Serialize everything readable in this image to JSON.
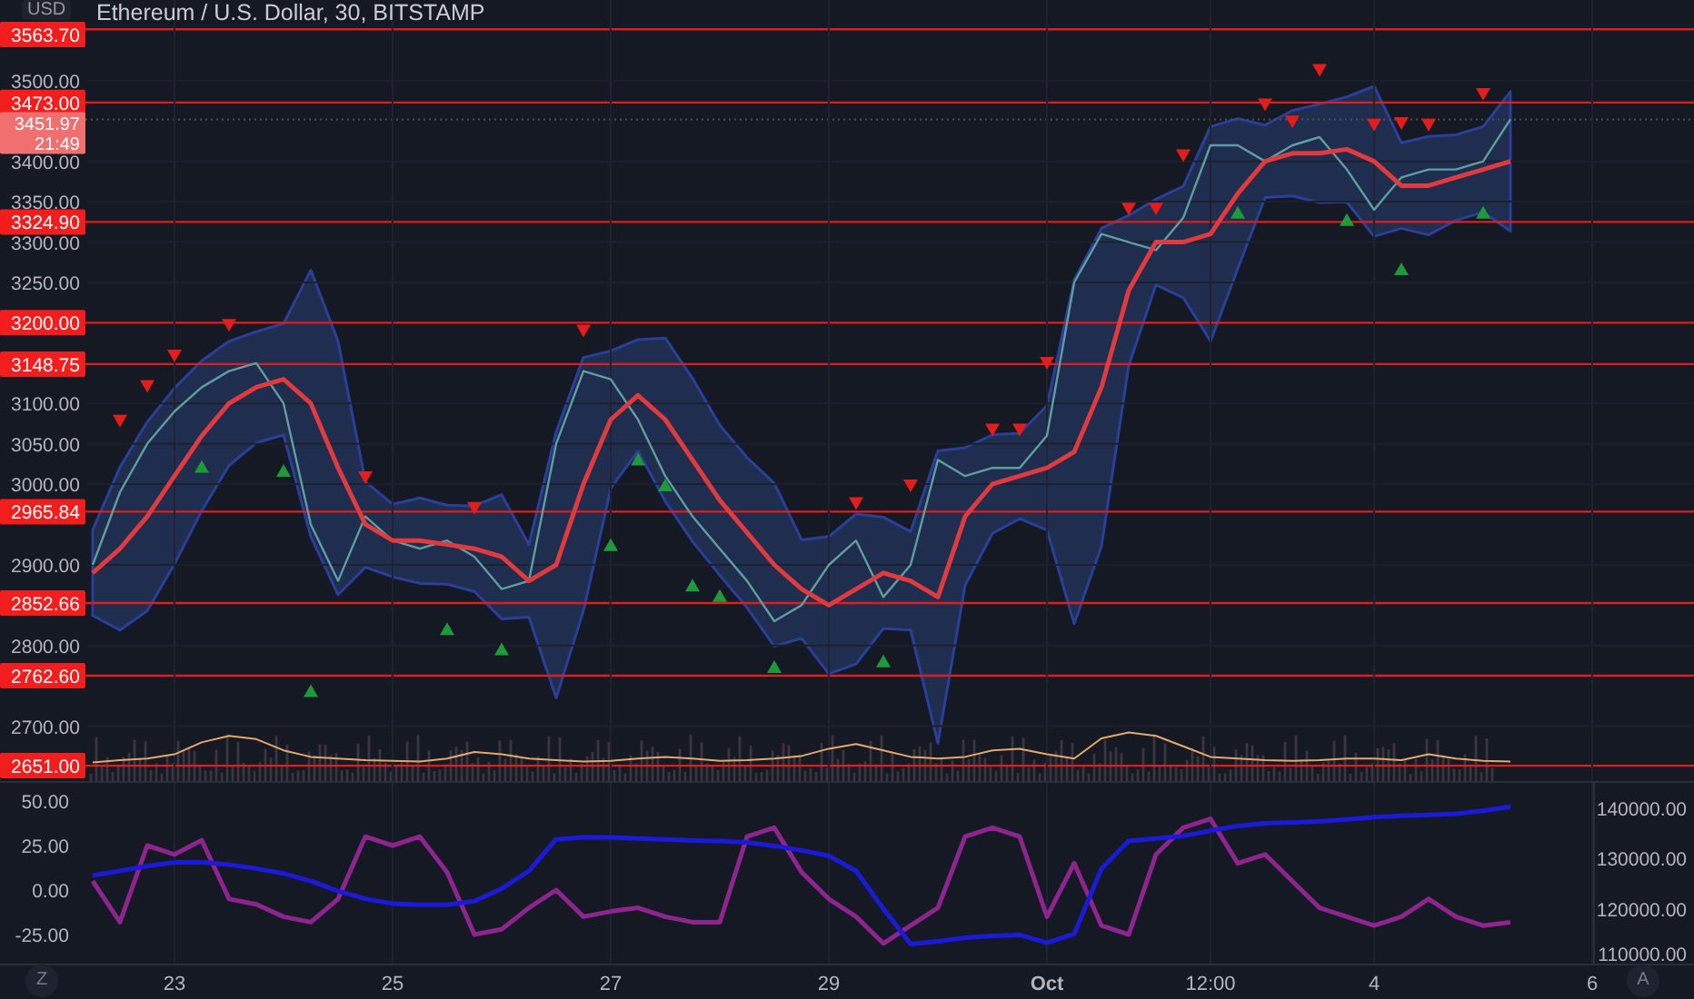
{
  "header": {
    "title": "Ethereum / U.S. Dollar, 30, BITSTAMP",
    "currency": "USD"
  },
  "price_chart": {
    "chart_data": {
      "type": "line",
      "grid": true,
      "series": [
        {
          "color": "#5f9ea0",
          "values": [
            2900,
            2990,
            3050,
            3090,
            3120,
            3140,
            3150,
            3100,
            2950,
            2880,
            2960,
            2930,
            2920,
            2930,
            2910,
            2870,
            2880,
            3050,
            3140,
            3130,
            3080,
            3010,
            2960,
            2920,
            2880,
            2830,
            2850,
            2900,
            2930,
            2860,
            2900,
            3030,
            3010,
            3020,
            3020,
            3060,
            3250,
            3310,
            3300,
            3290,
            3330,
            3420,
            3420,
            3400,
            3420,
            3430,
            3390,
            3340,
            3380,
            3390,
            3390,
            3400,
            3452
          ]
        },
        {
          "color": "#e03a3e",
          "values": [
            2890,
            2920,
            2960,
            3010,
            3060,
            3100,
            3120,
            3130,
            3100,
            3020,
            2950,
            2930,
            2930,
            2925,
            2920,
            2910,
            2880,
            2900,
            3000,
            3080,
            3110,
            3080,
            3030,
            2980,
            2940,
            2900,
            2870,
            2850,
            2870,
            2890,
            2880,
            2860,
            2960,
            3000,
            3010,
            3020,
            3040,
            3120,
            3240,
            3300,
            3300,
            3310,
            3360,
            3400,
            3410,
            3410,
            3415,
            3400,
            3370,
            3370,
            3380,
            3390,
            3400
          ]
        },
        {
          "type": "scatter",
          "color": "#e31c1c",
          "values": [
            null,
            3079,
            3122,
            3160,
            null,
            3198,
            null,
            null,
            null,
            null,
            3009,
            null,
            null,
            null,
            2971,
            null,
            null,
            null,
            3191,
            null,
            null,
            null,
            null,
            null,
            null,
            null,
            null,
            null,
            2977,
            null,
            2999,
            null,
            null,
            3068,
            3068,
            3151,
            null,
            null,
            3342,
            3342,
            3408,
            null,
            null,
            3471,
            3450,
            3514,
            null,
            3446,
            3448,
            3446,
            null,
            3484,
            null
          ]
        },
        {
          "type": "scatter",
          "color": "#1f9a3a",
          "values": [
            null,
            null,
            null,
            null,
            3023,
            null,
            null,
            3018,
            2745,
            null,
            null,
            null,
            null,
            2822,
            null,
            2797,
            null,
            null,
            null,
            2926,
            3032,
            3000,
            2876,
            2863,
            null,
            2775,
            null,
            null,
            null,
            2782,
            null,
            null,
            null,
            null,
            null,
            null,
            null,
            null,
            null,
            null,
            null,
            null,
            3338,
            null,
            null,
            null,
            3329,
            null,
            3268,
            null,
            null,
            3338,
            null
          ]
        },
        {
          "color": "#e6a86a",
          "values": [
            2655,
            2658,
            2660,
            2665,
            2680,
            2688,
            2684,
            2670,
            2662,
            2660,
            2658,
            2657,
            2656,
            2660,
            2668,
            2665,
            2660,
            2658,
            2656,
            2657,
            2660,
            2662,
            2660,
            2657,
            2658,
            2660,
            2663,
            2672,
            2678,
            2670,
            2662,
            2660,
            2662,
            2670,
            2672,
            2665,
            2660,
            2685,
            2692,
            2688,
            2675,
            2662,
            2660,
            2658,
            2657,
            2658,
            2660,
            2660,
            2658,
            2665,
            2660,
            2657,
            2656
          ]
        }
      ],
      "ylim": [
        2632,
        3600
      ],
      "yticks": [
        {
          "value": 3500,
          "label": "3500.00"
        },
        {
          "value": 3400,
          "label": "3400.00"
        },
        {
          "value": 3350,
          "label": "3350.00"
        },
        {
          "value": 3300,
          "label": "3300.00"
        },
        {
          "value": 3250,
          "label": "3250.00"
        },
        {
          "value": 3100,
          "label": "3100.00"
        },
        {
          "value": 3050,
          "label": "3050.00"
        },
        {
          "value": 3000,
          "label": "3000.00"
        },
        {
          "value": 2900,
          "label": "2900.00"
        },
        {
          "value": 2800,
          "label": "2800.00"
        },
        {
          "value": 2700,
          "label": "2700.00"
        }
      ]
    }
  },
  "price_levels": [
    {
      "label": "3563.70"
    },
    {
      "label": "3473.00"
    },
    {
      "label": "3324.90"
    },
    {
      "label": "3200.00"
    },
    {
      "label": "3148.75"
    },
    {
      "label": "2965.84"
    },
    {
      "label": "2852.66"
    },
    {
      "label": "2762.60"
    },
    {
      "label": "2651.00"
    }
  ],
  "last_price": {
    "price": "3451.97",
    "countdown": "21:49"
  },
  "oscillator": {
    "chart_data": {
      "type": "line",
      "grid": true,
      "categories": [
        null,
        null,
        null,
        "23",
        null,
        null,
        null,
        null,
        null,
        null,
        null,
        "25",
        null,
        null,
        null,
        null,
        null,
        null,
        null,
        "27",
        null,
        null,
        null,
        null,
        null,
        null,
        null,
        "29",
        null,
        null,
        null,
        null,
        null,
        null,
        null,
        "Oct",
        null,
        null,
        null,
        null,
        null,
        "12:00",
        null,
        null,
        null,
        null,
        null,
        "4",
        null,
        null,
        null,
        null,
        null,
        null,
        null,
        "6",
        null
      ],
      "series": [
        {
          "color": "#8e248e",
          "values": [
            5,
            -18,
            25,
            20,
            28,
            -5,
            -8,
            -15,
            -18,
            -5,
            30,
            25,
            30,
            10,
            -25,
            -22,
            -10,
            0,
            -15,
            -12,
            -10,
            -15,
            -18,
            -18,
            30,
            35,
            10,
            -5,
            -15,
            -30,
            -20,
            -10,
            30,
            35,
            30,
            -15,
            15,
            -20,
            -25,
            20,
            35,
            40,
            15,
            20,
            5,
            -10,
            -15,
            -20,
            -15,
            -5,
            -15,
            -20,
            -18,
            null,
            null,
            null,
            null
          ]
        }
      ],
      "ylim": [
        -41.8,
        60.2
      ],
      "yticks": [
        {
          "value": 50,
          "label": "50.00"
        },
        {
          "value": 25,
          "label": "25.00"
        },
        {
          "value": 0,
          "label": "0.00"
        },
        {
          "value": -25,
          "label": "-25.00"
        }
      ]
    }
  },
  "index_line": {
    "chart_data": {
      "type": "line",
      "series": [
        {
          "color": "#1a1ad8",
          "values": [
            126600,
            127500,
            128500,
            129200,
            129300,
            128800,
            128000,
            127000,
            125500,
            123500,
            122000,
            121000,
            120800,
            120800,
            121500,
            124000,
            127500,
            133800,
            134200,
            134200,
            134000,
            133800,
            133600,
            133500,
            133200,
            132500,
            131600,
            130500,
            127500,
            120000,
            113000,
            113500,
            114200,
            114600,
            114800,
            113200,
            115000,
            128000,
            133500,
            134000,
            134500,
            135500,
            136500,
            137000,
            137200,
            137400,
            137800,
            138200,
            138500,
            138700,
            138900,
            139500,
            140300
          ]
        }
      ],
      "ylim": [
        108900,
        145050
      ],
      "yticks": [
        {
          "value": 140000,
          "label": "140000.00"
        },
        {
          "value": 130000,
          "label": "130000.00"
        },
        {
          "value": 120000,
          "label": "120000.00"
        },
        {
          "value": 110000,
          "label": "110000.00"
        }
      ]
    }
  },
  "buttons": [
    {
      "label": "Z"
    },
    {
      "label": "A"
    }
  ]
}
